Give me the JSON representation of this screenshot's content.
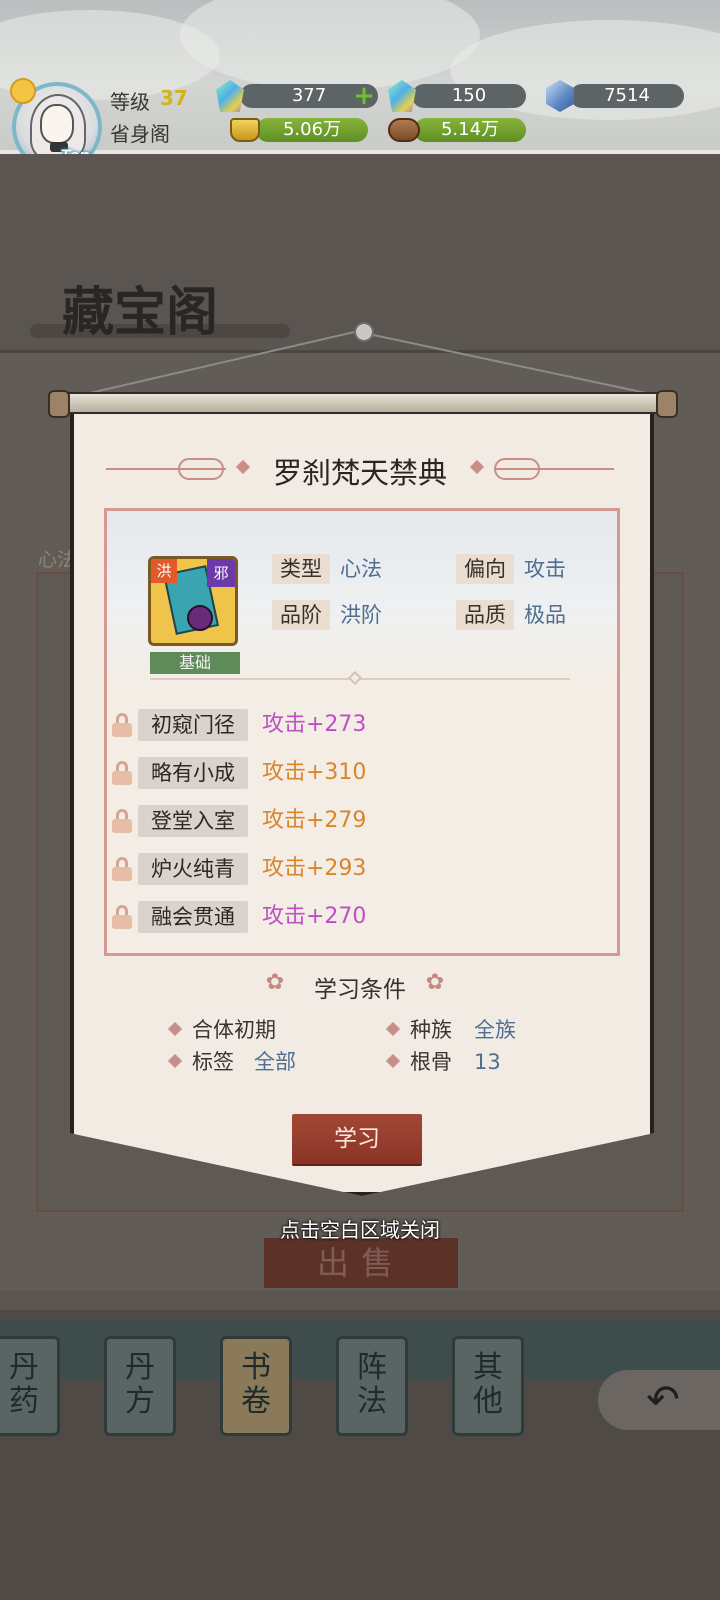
{
  "header": {
    "avatar_badge": "Tap",
    "level_label": "等级",
    "level_value": "37",
    "sect_name": "省身阁",
    "resources": {
      "green_gem": "377",
      "rainbow_gem": "150",
      "blue_crystal": "7514",
      "gold": "5.06万",
      "wood": "5.14万"
    }
  },
  "background": {
    "title": "藏宝阁",
    "tab_label": "心法",
    "sell_button": "出售",
    "categories": [
      {
        "top": "丹",
        "bottom": "药"
      },
      {
        "top": "丹",
        "bottom": "方"
      },
      {
        "top": "书",
        "bottom": "卷"
      },
      {
        "top": "阵",
        "bottom": "法"
      },
      {
        "top": "其",
        "bottom": "他"
      }
    ],
    "active_category": "书卷",
    "back_icon": "back-arrow-icon"
  },
  "dialog": {
    "title": "罗刹梵天禁典",
    "book_tag_left": "洪",
    "book_tag_right": "邪",
    "book_badge": "基础",
    "properties": [
      {
        "key": "类型",
        "value": "心法"
      },
      {
        "key": "偏向",
        "value": "攻击"
      },
      {
        "key": "品阶",
        "value": "洪阶"
      },
      {
        "key": "品质",
        "value": "极品"
      }
    ],
    "stages": [
      {
        "label": "初窥门径",
        "bonus": "攻击+273",
        "color": "#c04ec4"
      },
      {
        "label": "略有小成",
        "bonus": "攻击+310",
        "color": "#d8862a"
      },
      {
        "label": "登堂入室",
        "bonus": "攻击+279",
        "color": "#d8862a"
      },
      {
        "label": "炉火纯青",
        "bonus": "攻击+293",
        "color": "#d8862a"
      },
      {
        "label": "融会贯通",
        "bonus": "攻击+270",
        "color": "#c04ec4"
      }
    ],
    "requirements_title": "学习条件",
    "requirements": [
      {
        "key": "合体初期",
        "value": ""
      },
      {
        "key": "种族",
        "value": "全族"
      },
      {
        "key": "标签",
        "value": "全部"
      },
      {
        "key": "根骨",
        "value": "13"
      }
    ],
    "learn_button": "学习",
    "close_hint": "点击空白区域关闭"
  }
}
